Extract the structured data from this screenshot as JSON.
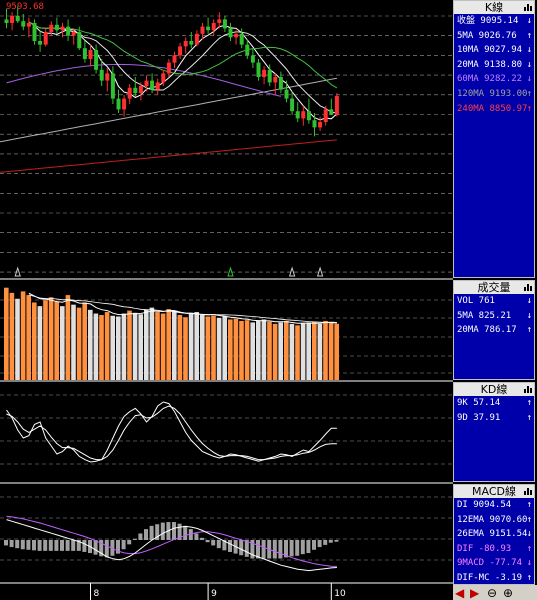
{
  "price_label": "9593.68",
  "k_panel": {
    "title": "K線",
    "rows": [
      {
        "label": "收盤",
        "value": "9095.14",
        "dir": "↓",
        "color": "#ffffff"
      },
      {
        "label": "5MA",
        "value": "9026.76",
        "dir": "↑",
        "color": "#ffffff"
      },
      {
        "label": "10MA",
        "value": "9027.94",
        "dir": "↓",
        "color": "#ffffff"
      },
      {
        "label": "20MA",
        "value": "9138.80",
        "dir": "↓",
        "color": "#ffffff"
      },
      {
        "label": "60MA",
        "value": "9282.22",
        "dir": "↓",
        "color": "#c080ff"
      },
      {
        "label": "120MA",
        "value": "9193.00",
        "dir": "↑",
        "color": "#a0a0a0"
      },
      {
        "label": "240MA",
        "value": "8850.97",
        "dir": "↑",
        "color": "#ff4040"
      }
    ]
  },
  "vol_panel": {
    "title": "成交量",
    "rows": [
      {
        "label": "VOL",
        "value": "761",
        "dir": "↓",
        "color": "#ffffff"
      },
      {
        "label": "5MA",
        "value": "825.21",
        "dir": "↓",
        "color": "#ffffff"
      },
      {
        "label": "20MA",
        "value": "786.17",
        "dir": "↑",
        "color": "#ffffff"
      }
    ]
  },
  "kd_panel": {
    "title": "KD線",
    "rows": [
      {
        "label": "9K",
        "value": "57.14",
        "dir": "↑",
        "color": "#ffffff"
      },
      {
        "label": "9D",
        "value": "37.91",
        "dir": "↑",
        "color": "#ffffff"
      }
    ]
  },
  "macd_panel": {
    "title": "MACD線",
    "rows": [
      {
        "label": "DI",
        "value": "9094.54",
        "dir": "↑",
        "color": "#ffffff"
      },
      {
        "label": "12EMA",
        "value": "9070.60",
        "dir": "↑",
        "color": "#ffffff"
      },
      {
        "label": "26EMA",
        "value": "9151.54",
        "dir": "↓",
        "color": "#ffffff"
      },
      {
        "label": "DIF",
        "value": "-80.93",
        "dir": "↑",
        "color": "#ff80ff"
      },
      {
        "label": "9MACD",
        "value": "-77.74",
        "dir": "↓",
        "color": "#ff80ff"
      },
      {
        "label": "DIF-MC",
        "value": "-3.19",
        "dir": "↑",
        "color": "#ffffff"
      }
    ]
  },
  "x_ticks": [
    "8",
    "9",
    "10"
  ],
  "icons": [
    "arrow-left-icon",
    "arrow-right-icon",
    "zoom-out-icon",
    "zoom-in-icon",
    "bar-chart-icon"
  ],
  "chart_data": {
    "type": "candlestick",
    "months": [
      "8",
      "9",
      "10"
    ],
    "candles": [
      {
        "o": 9520,
        "h": 9580,
        "l": 9470,
        "c": 9500
      },
      {
        "o": 9500,
        "h": 9560,
        "l": 9460,
        "c": 9540
      },
      {
        "o": 9540,
        "h": 9593.68,
        "l": 9500,
        "c": 9510
      },
      {
        "o": 9510,
        "h": 9550,
        "l": 9460,
        "c": 9480
      },
      {
        "o": 9480,
        "h": 9530,
        "l": 9420,
        "c": 9500
      },
      {
        "o": 9500,
        "h": 9520,
        "l": 9380,
        "c": 9400
      },
      {
        "o": 9400,
        "h": 9460,
        "l": 9340,
        "c": 9380
      },
      {
        "o": 9380,
        "h": 9470,
        "l": 9370,
        "c": 9450
      },
      {
        "o": 9450,
        "h": 9510,
        "l": 9430,
        "c": 9490
      },
      {
        "o": 9490,
        "h": 9530,
        "l": 9440,
        "c": 9460
      },
      {
        "o": 9460,
        "h": 9500,
        "l": 9420,
        "c": 9480
      },
      {
        "o": 9480,
        "h": 9520,
        "l": 9400,
        "c": 9430
      },
      {
        "o": 9430,
        "h": 9470,
        "l": 9380,
        "c": 9450
      },
      {
        "o": 9450,
        "h": 9480,
        "l": 9350,
        "c": 9360
      },
      {
        "o": 9360,
        "h": 9400,
        "l": 9280,
        "c": 9300
      },
      {
        "o": 9300,
        "h": 9380,
        "l": 9260,
        "c": 9350
      },
      {
        "o": 9350,
        "h": 9380,
        "l": 9220,
        "c": 9240
      },
      {
        "o": 9240,
        "h": 9300,
        "l": 9150,
        "c": 9180
      },
      {
        "o": 9180,
        "h": 9250,
        "l": 9120,
        "c": 9220
      },
      {
        "o": 9220,
        "h": 9260,
        "l": 9050,
        "c": 9080
      },
      {
        "o": 9080,
        "h": 9130,
        "l": 9000,
        "c": 9020
      },
      {
        "o": 9020,
        "h": 9100,
        "l": 8980,
        "c": 9080
      },
      {
        "o": 9080,
        "h": 9160,
        "l": 9050,
        "c": 9140
      },
      {
        "o": 9140,
        "h": 9200,
        "l": 9090,
        "c": 9110
      },
      {
        "o": 9110,
        "h": 9170,
        "l": 9070,
        "c": 9150
      },
      {
        "o": 9150,
        "h": 9210,
        "l": 9120,
        "c": 9180
      },
      {
        "o": 9180,
        "h": 9220,
        "l": 9110,
        "c": 9130
      },
      {
        "o": 9130,
        "h": 9190,
        "l": 9100,
        "c": 9170
      },
      {
        "o": 9170,
        "h": 9240,
        "l": 9150,
        "c": 9220
      },
      {
        "o": 9220,
        "h": 9300,
        "l": 9200,
        "c": 9280
      },
      {
        "o": 9280,
        "h": 9340,
        "l": 9250,
        "c": 9320
      },
      {
        "o": 9320,
        "h": 9390,
        "l": 9300,
        "c": 9370
      },
      {
        "o": 9370,
        "h": 9420,
        "l": 9330,
        "c": 9400
      },
      {
        "o": 9400,
        "h": 9450,
        "l": 9360,
        "c": 9380
      },
      {
        "o": 9380,
        "h": 9460,
        "l": 9370,
        "c": 9440
      },
      {
        "o": 9440,
        "h": 9500,
        "l": 9410,
        "c": 9480
      },
      {
        "o": 9480,
        "h": 9530,
        "l": 9440,
        "c": 9460
      },
      {
        "o": 9460,
        "h": 9520,
        "l": 9430,
        "c": 9500
      },
      {
        "o": 9500,
        "h": 9560,
        "l": 9470,
        "c": 9520
      },
      {
        "o": 9520,
        "h": 9540,
        "l": 9450,
        "c": 9470
      },
      {
        "o": 9470,
        "h": 9500,
        "l": 9400,
        "c": 9420
      },
      {
        "o": 9420,
        "h": 9460,
        "l": 9380,
        "c": 9440
      },
      {
        "o": 9440,
        "h": 9470,
        "l": 9360,
        "c": 9380
      },
      {
        "o": 9380,
        "h": 9410,
        "l": 9300,
        "c": 9320
      },
      {
        "o": 9320,
        "h": 9360,
        "l": 9250,
        "c": 9280
      },
      {
        "o": 9280,
        "h": 9300,
        "l": 9180,
        "c": 9200
      },
      {
        "o": 9200,
        "h": 9260,
        "l": 9160,
        "c": 9240
      },
      {
        "o": 9240,
        "h": 9270,
        "l": 9150,
        "c": 9170
      },
      {
        "o": 9170,
        "h": 9220,
        "l": 9100,
        "c": 9200
      },
      {
        "o": 9200,
        "h": 9230,
        "l": 9110,
        "c": 9130
      },
      {
        "o": 9130,
        "h": 9180,
        "l": 9060,
        "c": 9080
      },
      {
        "o": 9080,
        "h": 9120,
        "l": 8990,
        "c": 9010
      },
      {
        "o": 9010,
        "h": 9060,
        "l": 8950,
        "c": 8970
      },
      {
        "o": 8970,
        "h": 9040,
        "l": 8930,
        "c": 9010
      },
      {
        "o": 9010,
        "h": 9080,
        "l": 8940,
        "c": 8960
      },
      {
        "o": 8960,
        "h": 9000,
        "l": 8870,
        "c": 8920
      },
      {
        "o": 8920,
        "h": 8980,
        "l": 8900,
        "c": 8950
      },
      {
        "o": 8950,
        "h": 9040,
        "l": 8930,
        "c": 9020
      },
      {
        "o": 9020,
        "h": 9080,
        "l": 8990,
        "c": 8990
      },
      {
        "o": 8990,
        "h": 9110,
        "l": 8980,
        "c": 9095.14
      }
    ],
    "ma240_start": 8650,
    "ma240_end": 8850.97,
    "ma120_start": 8800,
    "ma120_end": 9193.0,
    "volume": [
      1250,
      1180,
      1100,
      1200,
      1150,
      1050,
      1000,
      1080,
      1120,
      1060,
      1000,
      1150,
      1020,
      980,
      1050,
      950,
      900,
      880,
      920,
      870,
      860,
      900,
      940,
      910,
      890,
      950,
      980,
      920,
      900,
      960,
      940,
      880,
      850,
      900,
      920,
      880,
      860,
      870,
      840,
      860,
      820,
      830,
      800,
      810,
      780,
      800,
      820,
      790,
      760,
      780,
      800,
      760,
      740,
      770,
      780,
      790,
      760,
      800,
      780,
      761
    ],
    "vol_colors": "w=white,o=orange",
    "vol_pattern": "oowooowooowowoowwoowwwowwwwooowoowwwoowwoooowwwoowowowwowooo",
    "k_values": [
      80,
      70,
      55,
      45,
      48,
      62,
      65,
      45,
      35,
      25,
      28,
      35,
      30,
      22,
      18,
      15,
      16,
      18,
      30,
      45,
      60,
      72,
      78,
      82,
      75,
      65,
      72,
      85,
      90,
      88,
      78,
      65,
      52,
      42,
      35,
      28,
      25,
      22,
      20,
      22,
      25,
      24,
      22,
      20,
      18,
      16,
      18,
      20,
      22,
      25,
      24,
      22,
      26,
      30,
      28,
      35,
      42,
      50,
      57.14,
      57.14
    ],
    "d_values": [
      75,
      72,
      65,
      56,
      52,
      56,
      60,
      55,
      46,
      38,
      33,
      33,
      32,
      28,
      24,
      20,
      18,
      18,
      22,
      30,
      42,
      55,
      65,
      73,
      74,
      70,
      71,
      76,
      82,
      85,
      82,
      75,
      65,
      55,
      46,
      38,
      32,
      27,
      23,
      22,
      23,
      23,
      23,
      22,
      20,
      18,
      18,
      19,
      20,
      22,
      23,
      23,
      24,
      26,
      27,
      30,
      34,
      37,
      37.91,
      37.91
    ],
    "dif": [
      60,
      55,
      50,
      45,
      40,
      35,
      30,
      25,
      20,
      15,
      10,
      5,
      0,
      -5,
      -12,
      -20,
      -30,
      -40,
      -50,
      -55,
      -58,
      -55,
      -48,
      -38,
      -25,
      -12,
      0,
      10,
      20,
      28,
      35,
      38,
      40,
      38,
      34,
      28,
      20,
      12,
      4,
      -4,
      -12,
      -20,
      -28,
      -36,
      -44,
      -50,
      -56,
      -62,
      -68,
      -74,
      -78,
      -82,
      -86,
      -88,
      -90,
      -88,
      -86,
      -84,
      -82,
      -80.93
    ],
    "macd": [
      70,
      68,
      65,
      62,
      58,
      54,
      50,
      45,
      40,
      35,
      30,
      25,
      20,
      15,
      10,
      4,
      -3,
      -10,
      -18,
      -26,
      -33,
      -38,
      -40,
      -40,
      -37,
      -32,
      -26,
      -19,
      -12,
      -5,
      2,
      8,
      14,
      18,
      22,
      24,
      24,
      22,
      19,
      15,
      10,
      5,
      0,
      -5,
      -10,
      -16,
      -22,
      -28,
      -34,
      -40,
      -46,
      -52,
      -57,
      -62,
      -66,
      -70,
      -73,
      -75,
      -77,
      -77.74
    ]
  }
}
